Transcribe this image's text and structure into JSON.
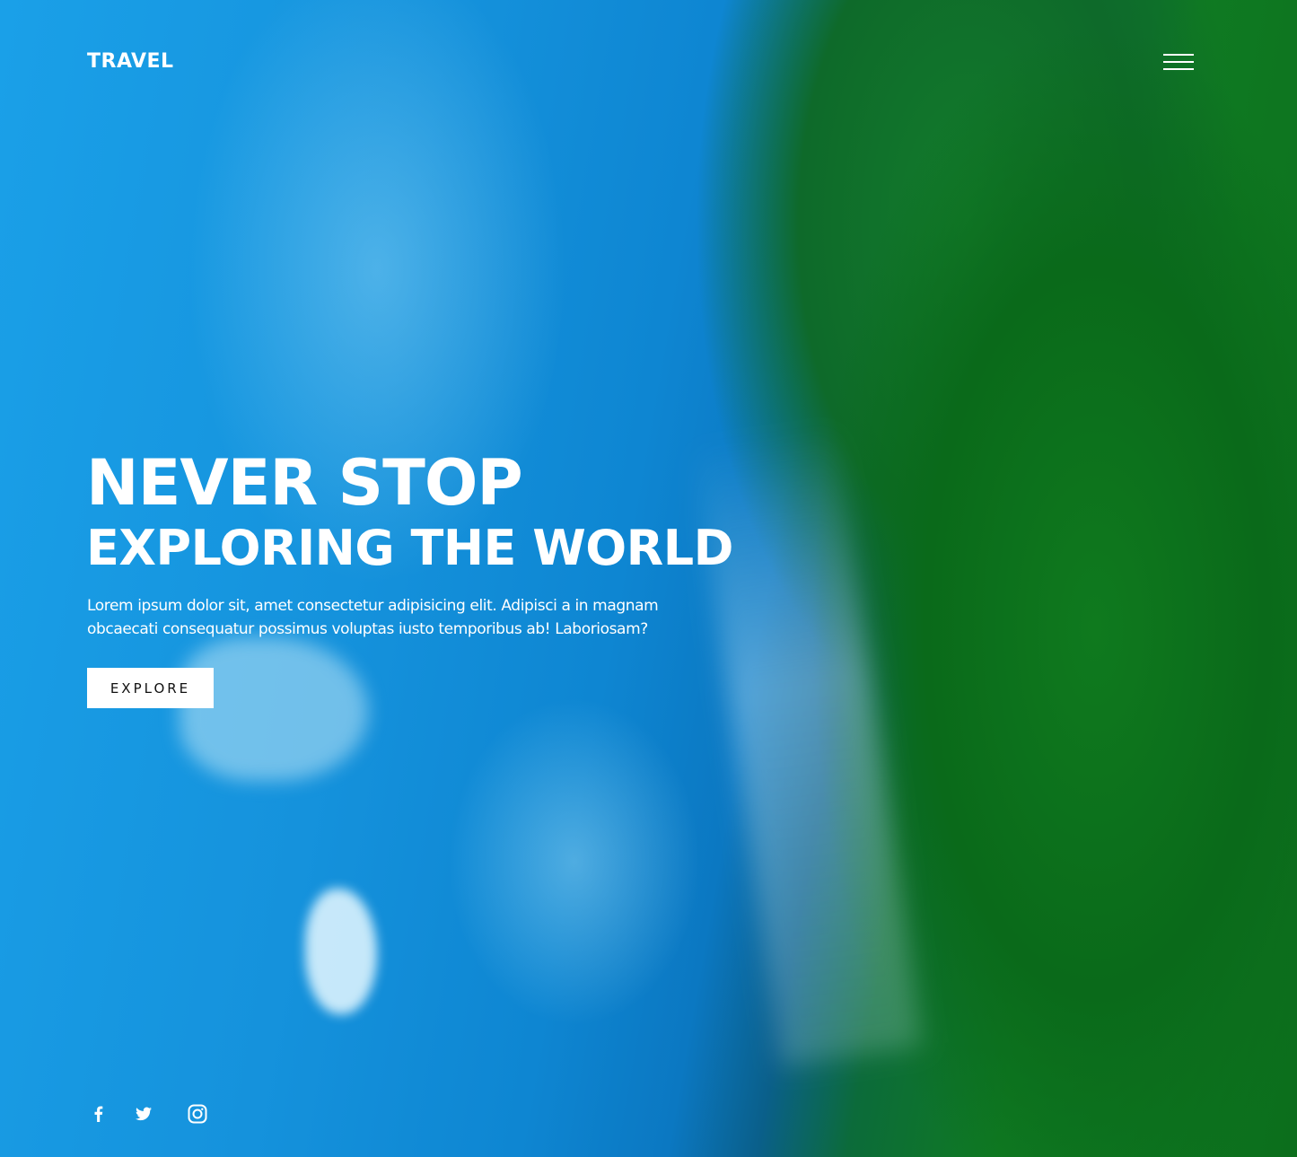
{
  "header": {
    "logo": "TRAVEL",
    "menu_icon": "hamburger-menu-icon"
  },
  "hero": {
    "headline_line1": "NEVER STOP",
    "headline_line2": "EXPLORING THE WORLD",
    "description": "Lorem ipsum dolor sit, amet consectetur adipisicing elit. Adipisci a in magnam obcaecati consequatur possimus voluptas iusto temporibus ab! Laboriosam?",
    "cta_label": "EXPLORE"
  },
  "social": [
    {
      "name": "facebook",
      "icon": "facebook-icon"
    },
    {
      "name": "twitter",
      "icon": "twitter-icon"
    },
    {
      "name": "instagram",
      "icon": "instagram-icon"
    }
  ],
  "colors": {
    "text": "#ffffff",
    "button_bg": "#ffffff",
    "button_text": "#111111",
    "water": "#1592dc",
    "foliage": "#0f7a22"
  }
}
